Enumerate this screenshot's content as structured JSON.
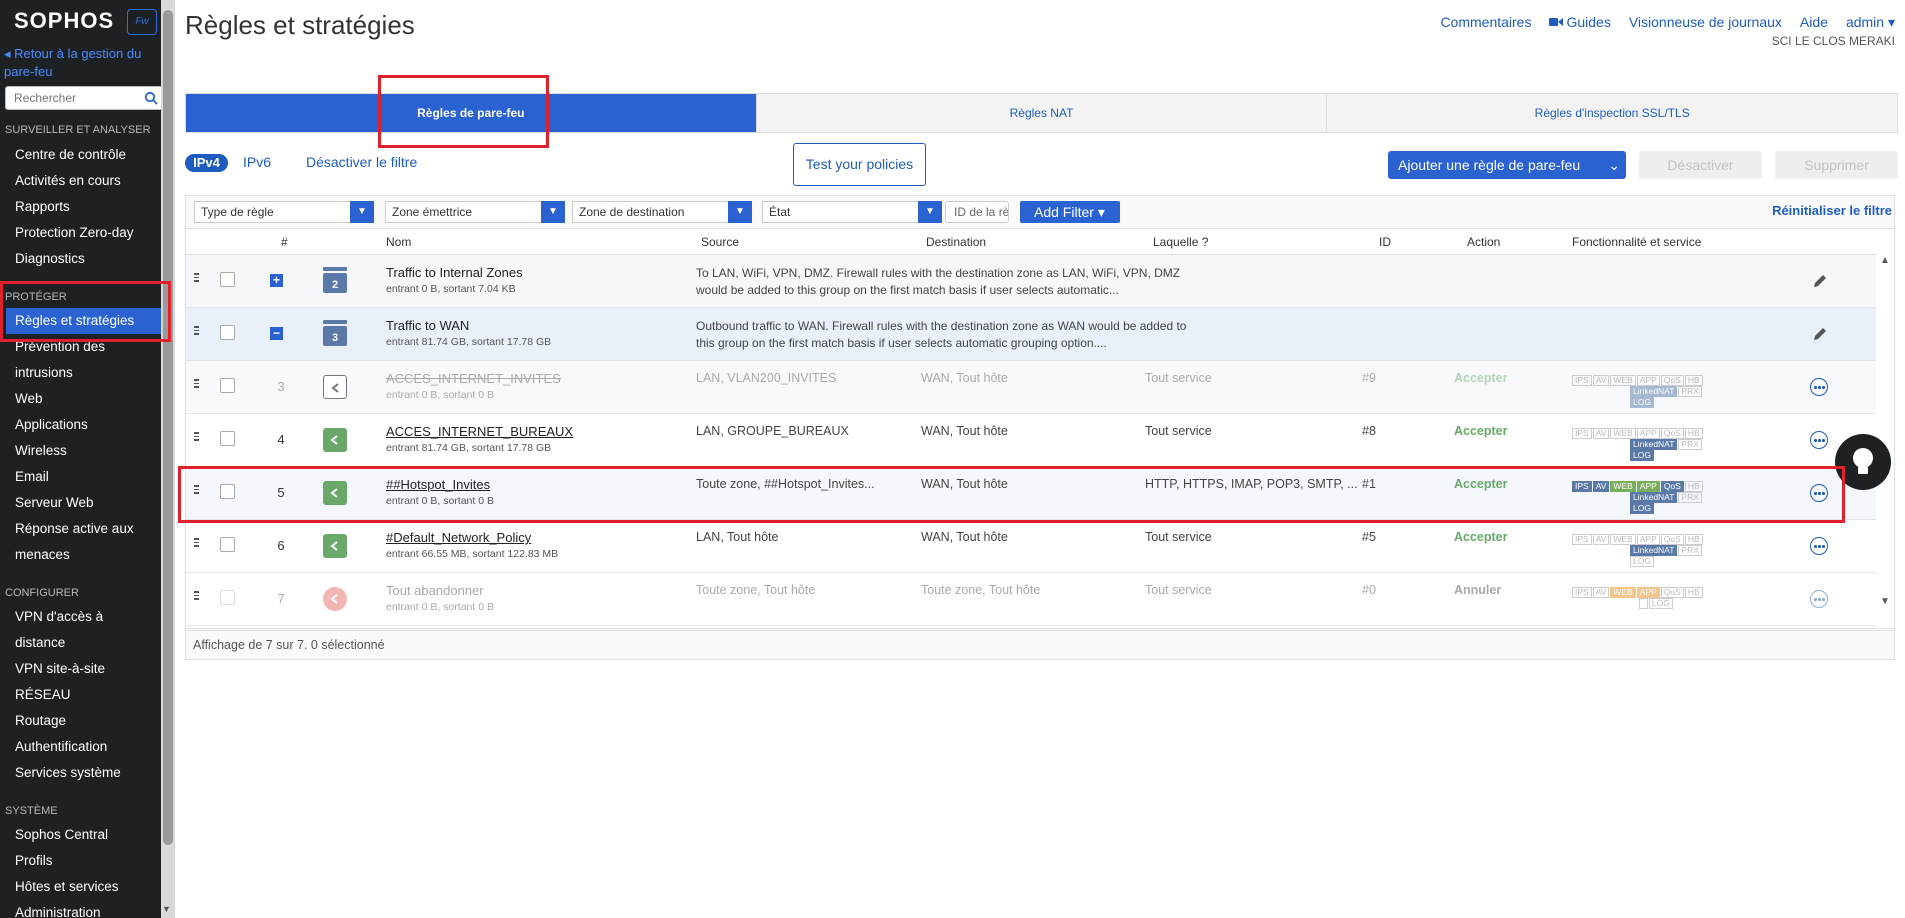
{
  "app": {
    "logo": "SOPHOS",
    "badge": "Fw",
    "back_link": "◂ Retour à la gestion du pare-feu",
    "search_placeholder": "Rechercher"
  },
  "sidebar": {
    "sections": [
      {
        "title": "SURVEILLER ET ANALYSER",
        "items": [
          "Centre de contrôle",
          "Activités en cours",
          "Rapports",
          "Protection Zero-day",
          "Diagnostics"
        ]
      },
      {
        "title": "PROTÉGER",
        "items": [
          "Règles et stratégies",
          "Prévention des",
          "intrusions",
          "Web",
          "Applications",
          "Wireless",
          "Email",
          "Serveur Web",
          "Réponse active aux",
          "menaces"
        ]
      },
      {
        "title": "CONFIGURER",
        "items": [
          "VPN d'accès à",
          "distance",
          "VPN site-à-site",
          "RÉSEAU",
          "Routage",
          "Authentification",
          "Services système"
        ]
      },
      {
        "title": "SYSTÈME",
        "items": [
          "Sophos Central",
          "Profils",
          "Hôtes et services",
          "Administration"
        ]
      }
    ],
    "active_item": "Règles et stratégies"
  },
  "header": {
    "title": "Règles et stratégies",
    "links": [
      "Commentaires",
      "Guides",
      "Visionneuse de journaux",
      "Aide",
      "admin"
    ],
    "tenant": "SCI LE CLOS MERAKI"
  },
  "tabs": [
    {
      "label": "Règles de pare-feu",
      "active": true
    },
    {
      "label": "Règles NAT",
      "active": false
    },
    {
      "label": "Règles d'inspection SSL/TLS",
      "active": false
    }
  ],
  "toolbar": {
    "ipv4": "IPv4",
    "ipv6": "IPv6",
    "disable_filter": "Désactiver le filtre",
    "test_policies": "Test your policies",
    "add_rule": "Ajouter une règle de pare-feu",
    "disable": "Désactiver",
    "delete": "Supprimer"
  },
  "filters": {
    "rule_type": "Type de règle",
    "source_zone": "Zone émettrice",
    "dest_zone": "Zone de destination",
    "state": "État",
    "rule_id_placeholder": "ID de la règle",
    "add_filter": "Add Filter",
    "reset": "Réinitialiser le filtre"
  },
  "table": {
    "columns": [
      "#",
      "Nom",
      "Source",
      "Destination",
      "Laquelle ?",
      "ID",
      "Action",
      "Fonctionnalité et service"
    ],
    "groups": [
      {
        "count": "2",
        "name": "Traffic to Internal Zones",
        "traffic": "entrant 0 B, sortant 7.04 KB",
        "desc": "To LAN, WiFi, VPN, DMZ. Firewall rules with the destination zone as LAN, WiFi, VPN, DMZ would be added to this group on the first match basis if user selects automatic..."
      },
      {
        "count": "3",
        "name": "Traffic to WAN",
        "traffic": "entrant 81.74 GB, sortant 17.78 GB",
        "desc": "Outbound traffic to WAN. Firewall rules with the destination zone as WAN would be added to this group on the first match basis if user selects automatic grouping option...."
      }
    ],
    "rows": [
      {
        "num": "3",
        "name": "ACCES_INTERNET_INVITES",
        "traffic": "entrant 0 B, sortant 0 B",
        "source": "LAN, VLAN200_INVITES",
        "destination": "WAN, Tout hôte",
        "which": "Tout service",
        "id": "#9",
        "action": "Accepter"
      },
      {
        "num": "4",
        "name": "ACCES_INTERNET_BUREAUX",
        "traffic": "entrant 81.74 GB, sortant 17.78 GB",
        "source": "LAN, GROUPE_BUREAUX",
        "destination": "WAN, Tout hôte",
        "which": "Tout service",
        "id": "#8",
        "action": "Accepter"
      },
      {
        "num": "5",
        "name": "##Hotspot_Invites",
        "traffic": "entrant 0 B, sortant 0 B",
        "source": "Toute zone, ##Hotspot_Invites...",
        "destination": "WAN, Tout hôte",
        "which": "HTTP, HTTPS, IMAP, POP3, SMTP, ...",
        "id": "#1",
        "action": "Accepter"
      },
      {
        "num": "6",
        "name": "#Default_Network_Policy",
        "traffic": "entrant 66.55 MB, sortant 122.83 MB",
        "source": "LAN, Tout hôte",
        "destination": "WAN, Tout hôte",
        "which": "Tout service",
        "id": "#5",
        "action": "Accepter"
      },
      {
        "num": "7",
        "name": "Tout abandonner",
        "traffic": "entrant 0 B, sortant 0 B",
        "source": "Toute zone, Tout hôte",
        "destination": "Toute zone, Tout hôte",
        "which": "Tout service",
        "id": "#0",
        "action": "Annuler"
      }
    ],
    "feature_tags": [
      "IPS",
      "AV",
      "WEB",
      "APP",
      "QoS",
      "HB",
      "LinkedNAT",
      "PRX",
      "LOG"
    ],
    "footer": "Affichage de 7 sur 7. 0 sélectionné"
  }
}
